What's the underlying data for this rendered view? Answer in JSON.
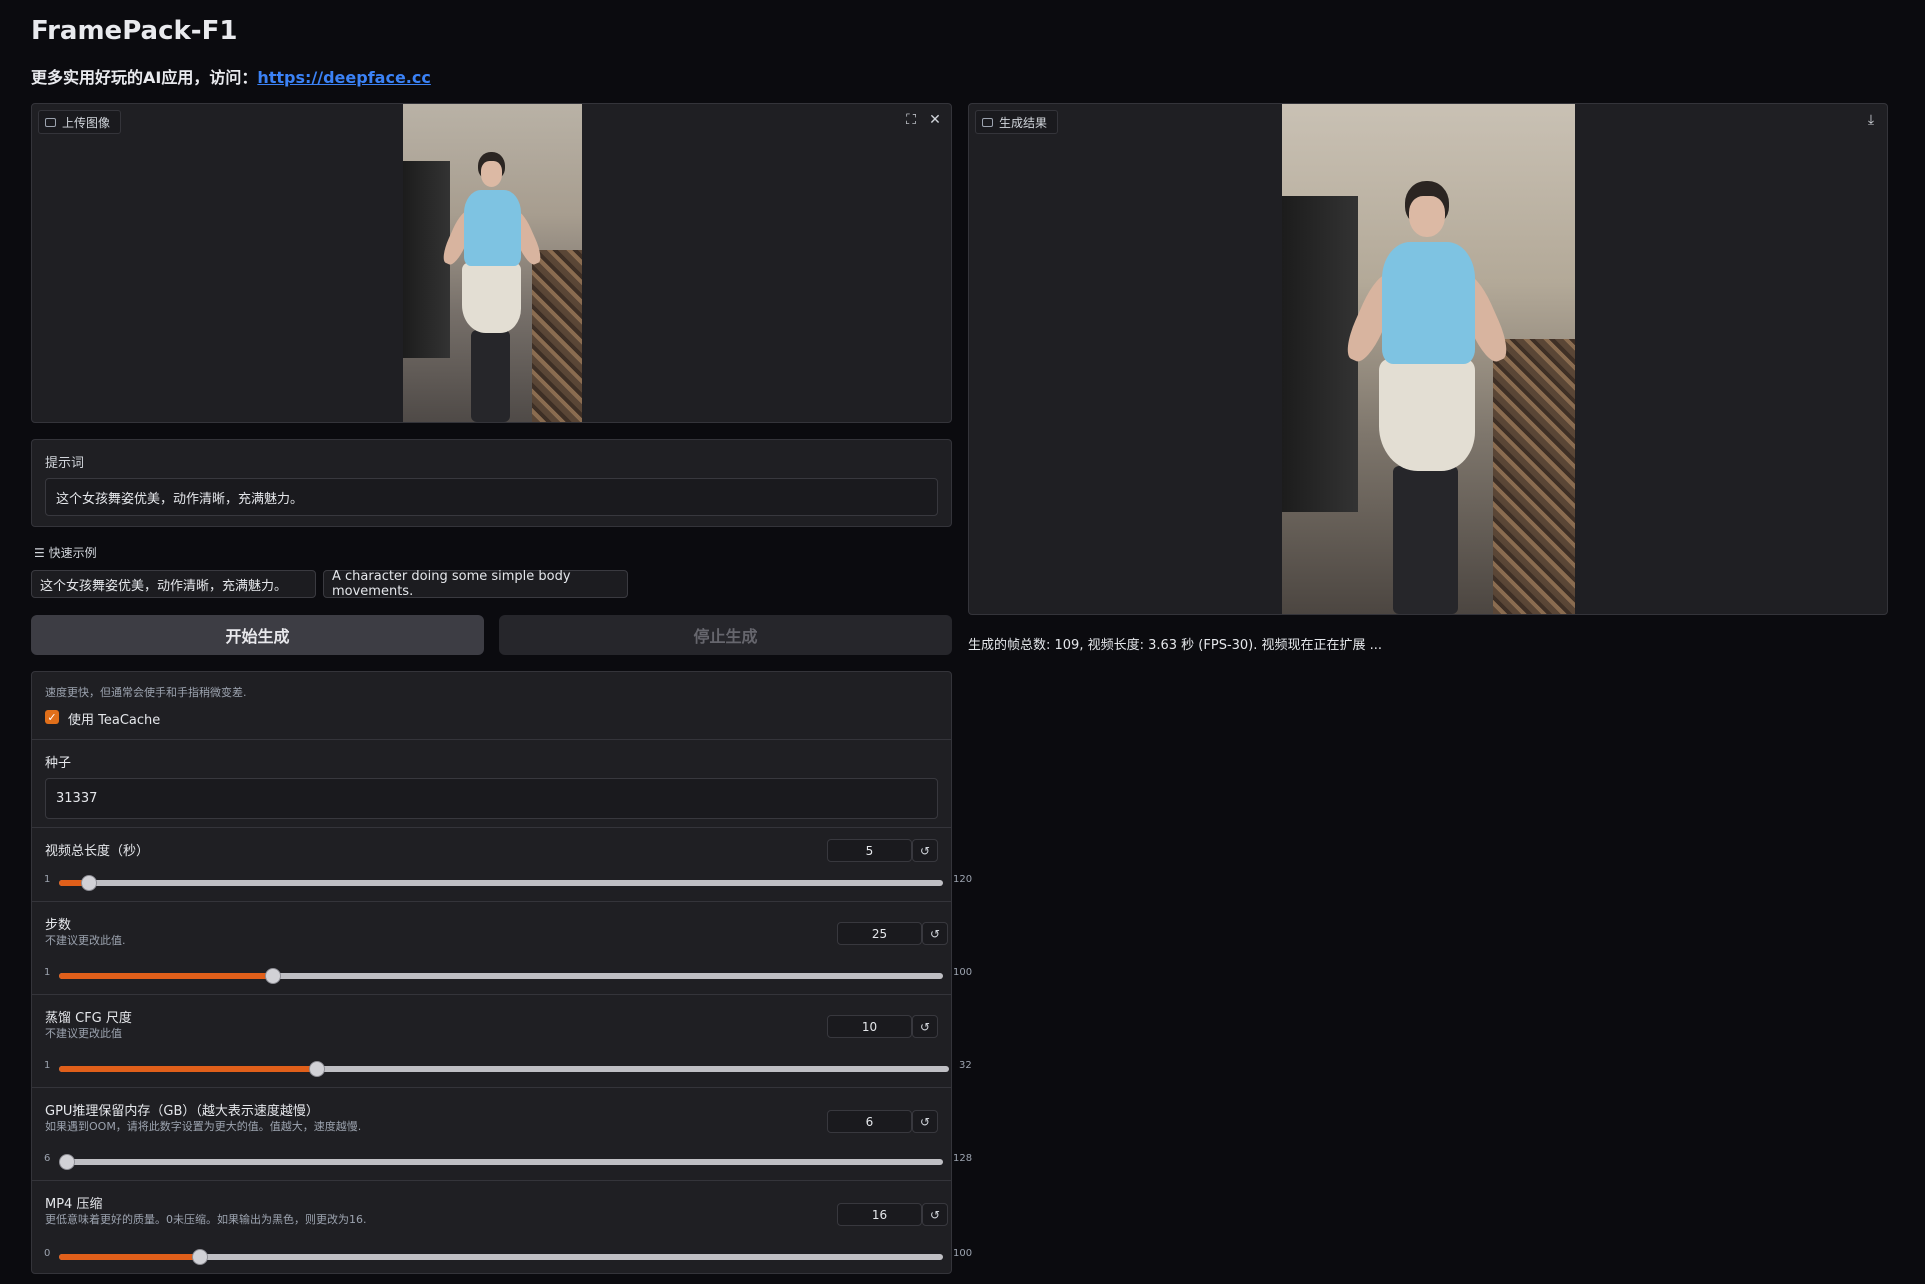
{
  "header": {
    "title": "FramePack-F1",
    "subtitle_prefix": "更多实用好玩的AI应用，访问：",
    "subtitle_link": "https://deepface.cc"
  },
  "upload_panel": {
    "label": "上传图像",
    "icon": "image-icon"
  },
  "result_panel": {
    "label": "生成结果",
    "icon": "video-icon"
  },
  "prompt": {
    "label": "提示词",
    "value": "这个女孩舞姿优美，动作清晰，充满魅力。"
  },
  "examples": {
    "label": "快速示例",
    "items": [
      "这个女孩舞姿优美，动作清晰，充满魅力。",
      "A character doing some simple body movements."
    ]
  },
  "buttons": {
    "start": "开始生成",
    "stop": "停止生成"
  },
  "teacache": {
    "desc": "速度更快，但通常会使手和手指稍微变差.",
    "label": "使用 TeaCache",
    "checked": true
  },
  "seed": {
    "label": "种子",
    "value": "31337"
  },
  "sliders": [
    {
      "label": "视频总长度（秒）",
      "desc": "",
      "value": "5",
      "min": "1",
      "max": "120",
      "fraction": 0.034
    },
    {
      "label": "步数",
      "desc": "不建议更改此值.",
      "value": "25",
      "min": "1",
      "max": "100",
      "fraction": 0.242
    },
    {
      "label": "蒸馏 CFG 尺度",
      "desc": "不建议更改此值",
      "value": "10",
      "min": "1",
      "max": "32",
      "fraction": 0.29
    },
    {
      "label": "GPU推理保留内存（GB）（越大表示速度越慢）",
      "desc": "如果遇到OOM，请将此数字设置为更大的值。值越大，速度越慢.",
      "value": "6",
      "min": "6",
      "max": "128",
      "fraction": 0.0
    },
    {
      "label": "MP4 压缩",
      "desc": "更低意味着更好的质量。0未压缩。如果输出为黑色，则更改为16.",
      "value": "16",
      "min": "0",
      "max": "100",
      "fraction": 0.16
    }
  ],
  "status": "生成的帧总数: 109, 视频长度: 3.63 秒 (FPS-30). 视频现在正在扩展 ...",
  "colors": {
    "accent": "#e05f1a",
    "link": "#3b82f6",
    "background": "#0b0b0f",
    "panel": "#1f1f23"
  }
}
